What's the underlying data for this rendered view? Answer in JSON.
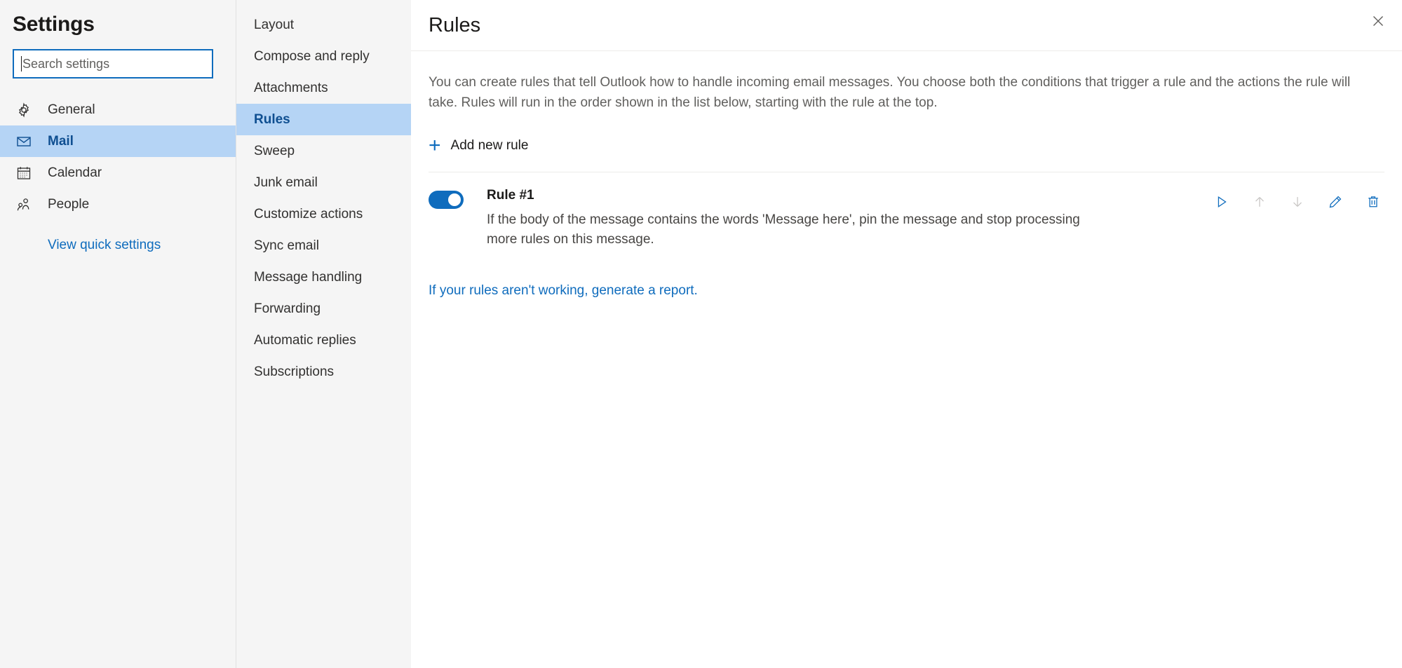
{
  "sidebar": {
    "title": "Settings",
    "search": {
      "placeholder": "Search settings",
      "value": ""
    },
    "items": [
      {
        "label": "General",
        "icon": "gear-icon",
        "selected": false
      },
      {
        "label": "Mail",
        "icon": "envelope-icon",
        "selected": true
      },
      {
        "label": "Calendar",
        "icon": "calendar-icon",
        "selected": false
      },
      {
        "label": "People",
        "icon": "people-icon",
        "selected": false
      }
    ],
    "quick_settings_link": "View quick settings"
  },
  "midcol": {
    "items": [
      {
        "label": "Layout",
        "selected": false
      },
      {
        "label": "Compose and reply",
        "selected": false
      },
      {
        "label": "Attachments",
        "selected": false
      },
      {
        "label": "Rules",
        "selected": true
      },
      {
        "label": "Sweep",
        "selected": false
      },
      {
        "label": "Junk email",
        "selected": false
      },
      {
        "label": "Customize actions",
        "selected": false
      },
      {
        "label": "Sync email",
        "selected": false
      },
      {
        "label": "Message handling",
        "selected": false
      },
      {
        "label": "Forwarding",
        "selected": false
      },
      {
        "label": "Automatic replies",
        "selected": false
      },
      {
        "label": "Subscriptions",
        "selected": false
      }
    ]
  },
  "main": {
    "title": "Rules",
    "close_label": "Close",
    "description": "You can create rules that tell Outlook how to handle incoming email messages. You choose both the conditions that trigger a rule and the actions the rule will take. Rules will run in the order shown in the list below, starting with the rule at the top.",
    "add_rule_label": "Add new rule",
    "rules": [
      {
        "name": "Rule #1",
        "enabled": true,
        "description": "If the body of the message contains the words 'Message here', pin the message and stop processing more rules on this message.",
        "actions": [
          {
            "name": "run-rule-icon",
            "enabled": true
          },
          {
            "name": "move-up-icon",
            "enabled": false
          },
          {
            "name": "move-down-icon",
            "enabled": false
          },
          {
            "name": "edit-rule-icon",
            "enabled": true
          },
          {
            "name": "delete-rule-icon",
            "enabled": true
          }
        ]
      }
    ],
    "report_link": "If your rules aren't working, generate a report."
  },
  "colors": {
    "accent": "#0f6cbd",
    "selection": "#b5d4f5",
    "selected_text": "#0f4f91",
    "panel_bg": "#f5f5f5",
    "body_text": "#1b1a19",
    "muted_text": "#61605e",
    "disabled_icon": "#c8c6c4"
  }
}
